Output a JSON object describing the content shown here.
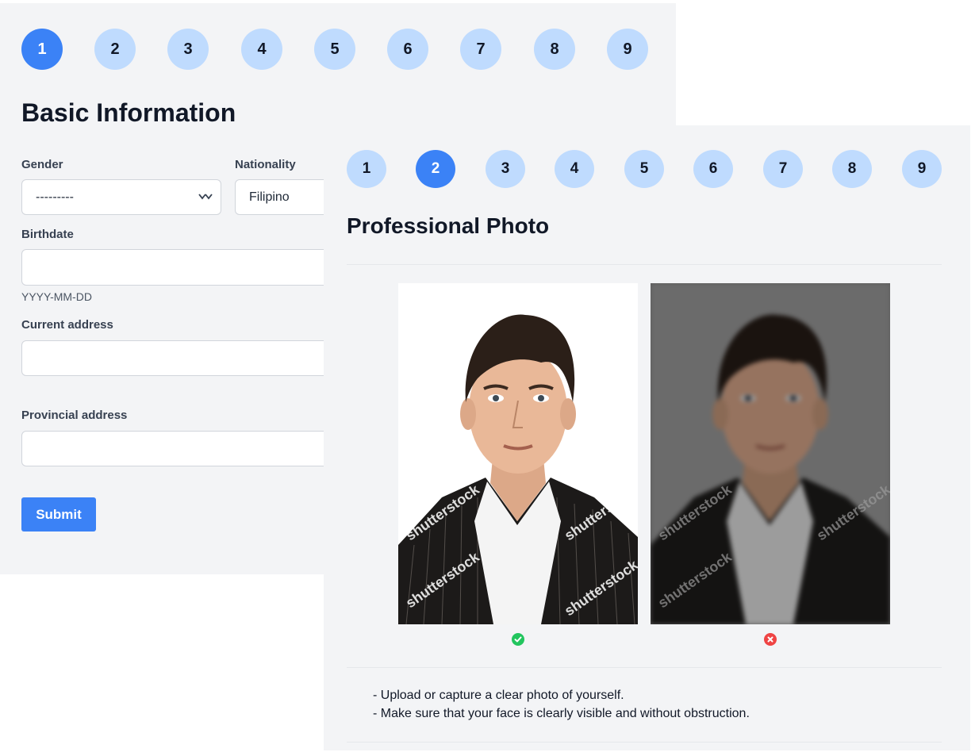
{
  "basic": {
    "steps": [
      "1",
      "2",
      "3",
      "4",
      "5",
      "6",
      "7",
      "8",
      "9"
    ],
    "active_step": 1,
    "title": "Basic Information",
    "gender": {
      "label": "Gender",
      "value": "---------"
    },
    "nationality": {
      "label": "Nationality",
      "value": "Filipino"
    },
    "birthdate": {
      "label": "Birthdate",
      "value": "",
      "hint": "YYYY-MM-DD"
    },
    "current_address": {
      "label": "Current address",
      "value": ""
    },
    "provincial_address": {
      "label": "Provincial address",
      "value": ""
    },
    "submit_label": "Submit"
  },
  "photo": {
    "steps": [
      "1",
      "2",
      "3",
      "4",
      "5",
      "6",
      "7",
      "8",
      "9"
    ],
    "active_step": 2,
    "title": "Professional Photo",
    "good_example": {
      "watermark": "shutterstock",
      "status": "check-icon"
    },
    "bad_example": {
      "watermark": "shutterstock",
      "status": "cross-icon"
    },
    "instructions": [
      "- Upload or capture a clear photo of yourself.",
      "- Make sure that your face is clearly visible and without obstruction."
    ]
  },
  "colors": {
    "accent": "#3b82f6",
    "step_inactive": "#bfdbfe",
    "success": "#22c55e",
    "error": "#ef4444"
  }
}
